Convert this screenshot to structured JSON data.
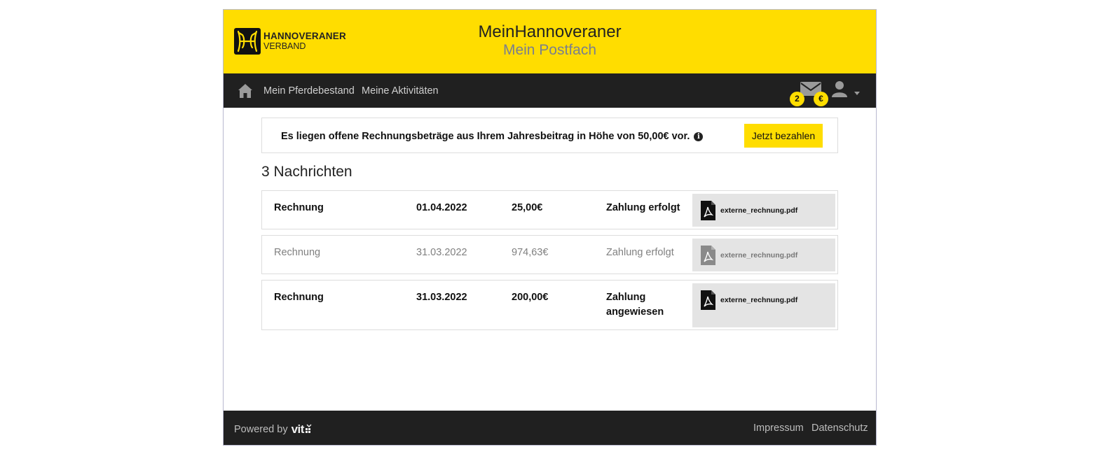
{
  "header": {
    "logo_line1": "HANNOVERANER",
    "logo_line2": "VERBAND",
    "title": "MeinHannoveraner",
    "subtitle": "Mein Postfach"
  },
  "nav": {
    "home_icon": "home-icon",
    "links": [
      "Mein Pferdebestand",
      "Meine Aktivitäten"
    ],
    "mail_badge": "2",
    "euro_badge": "€"
  },
  "alert": {
    "text": "Es liegen offene Rechnungsbeträge aus Ihrem Jahresbeitrag in Höhe von 50,00€ vor.",
    "button": "Jetzt bezahlen"
  },
  "messages": {
    "count_label": "3 Nachrichten",
    "rows": [
      {
        "type": "Rechnung",
        "date": "01.04.2022",
        "amount": "25,00€",
        "status": "Zahlung erfolgt",
        "file": "externe_rechnung.pdf",
        "read": false
      },
      {
        "type": "Rechnung",
        "date": "31.03.2022",
        "amount": "974,63€",
        "status": "Zahlung erfolgt",
        "file": "externe_rechnung.pdf",
        "read": true
      },
      {
        "type": "Rechnung",
        "date": "31.03.2022",
        "amount": "200,00€",
        "status": "Zahlung angewiesen",
        "file": "externe_rechnung.pdf",
        "read": false
      }
    ]
  },
  "footer": {
    "powered_by": "Powered by",
    "brand": "vit",
    "links": [
      "Impressum",
      "Datenschutz"
    ]
  },
  "colors": {
    "brand_yellow": "#ffdd00",
    "dark_bar": "#202020",
    "subtitle_grey": "#7a7f8e"
  }
}
